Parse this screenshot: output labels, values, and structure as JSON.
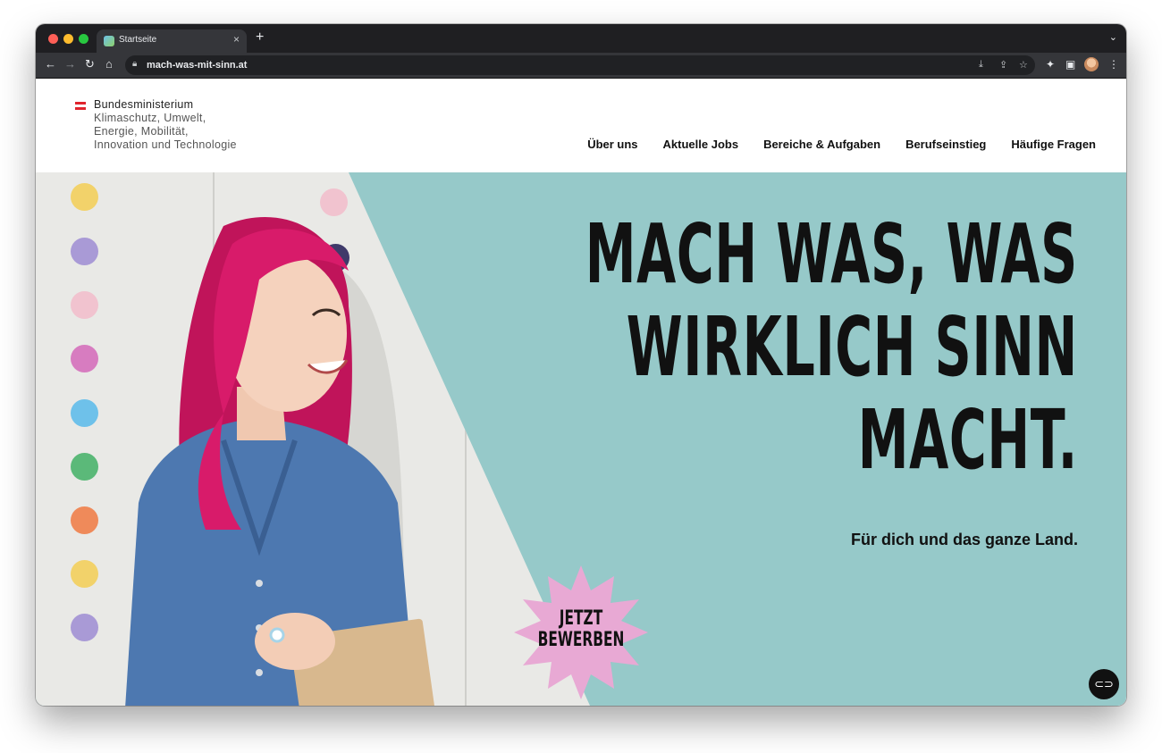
{
  "browser": {
    "tab_title": "Startseite",
    "tab_close": "×",
    "new_tab": "+",
    "tab_search": "⌄",
    "url": "mach-was-mit-sinn.at",
    "back": "←",
    "forward": "→",
    "reload": "↻",
    "home": "⌂",
    "lock": "🔒",
    "install": "⤓",
    "share": "⇪",
    "star": "☆",
    "extensions": "✦",
    "sidepanel": "▣",
    "menu": "⋮"
  },
  "header": {
    "ministry_lines": [
      "Bundesministerium",
      "Klimaschutz, Umwelt,",
      "Energie, Mobilität,",
      "Innovation und Technologie"
    ]
  },
  "nav": {
    "items": [
      "Über uns",
      "Aktuelle Jobs",
      "Bereiche & Aufgaben",
      "Berufseinstieg",
      "Häufige Fragen"
    ]
  },
  "hero": {
    "headline_lines": [
      "MACH WAS, WAS",
      "WIRKLICH SINN",
      "MACHT."
    ],
    "subline": "Für dich und das ganze Land.",
    "badge_lines": [
      "JETZT",
      "BEWERBEN"
    ],
    "badge_color": "#e8a9d4",
    "background_color": "#96c9c9"
  },
  "chat_button": {
    "icon": "chat-bubble-icon",
    "glyph": "⊂⊃"
  },
  "colors": {
    "flag_red": "#e0242d",
    "hero_teal": "#96c9c9",
    "hair": "#d81b6a",
    "denim": "#4d78b0"
  }
}
